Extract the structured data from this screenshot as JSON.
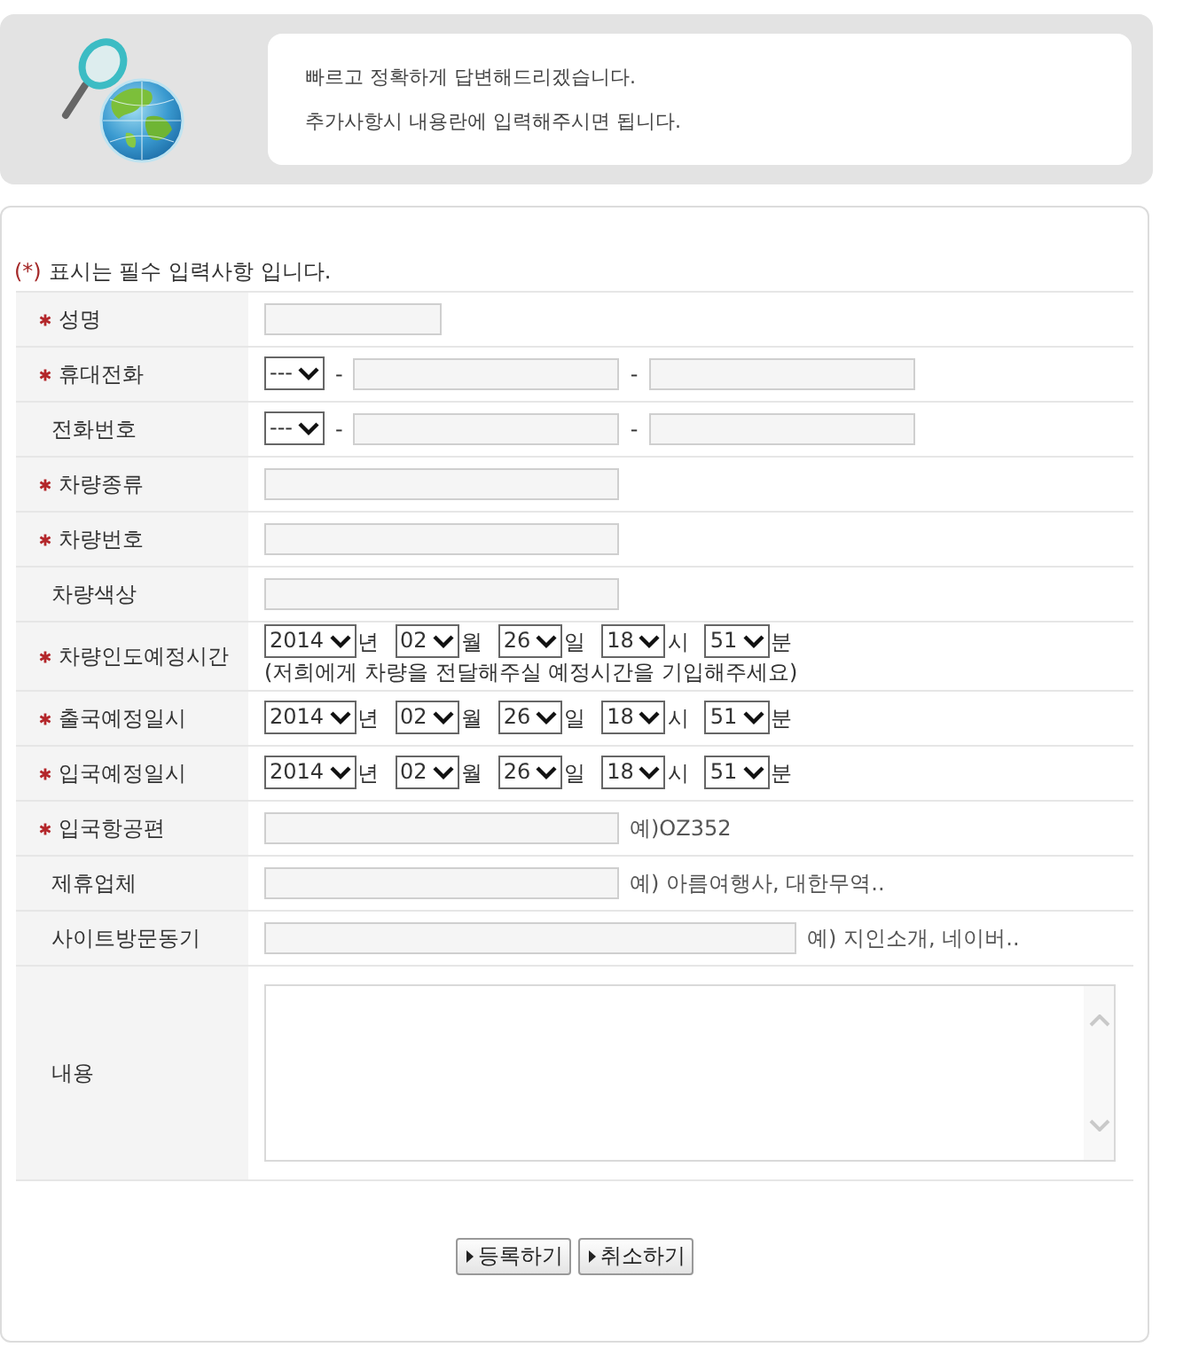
{
  "header": {
    "lines": [
      "빠르고 정확하게 답변해드리겠습니다.",
      "추가사항시 내용란에 입력해주시면 됩니다."
    ]
  },
  "notice": {
    "marker": "(*)",
    "text": "표시는 필수 입력사항 입니다."
  },
  "form_rows": [
    {
      "label": "성명",
      "required": true,
      "parts": [
        {
          "kind": "short-input"
        }
      ]
    },
    {
      "label": "휴대전화",
      "required": true,
      "parts": [
        {
          "kind": "select",
          "value": "---"
        },
        {
          "kind": "separator",
          "text": "-"
        },
        {
          "kind": "phone-input"
        },
        {
          "kind": "separator",
          "text": "-"
        },
        {
          "kind": "phone-input"
        }
      ]
    },
    {
      "label": "전화번호",
      "required": false,
      "parts": [
        {
          "kind": "select",
          "value": "---"
        },
        {
          "kind": "separator",
          "text": "-"
        },
        {
          "kind": "phone-input"
        },
        {
          "kind": "separator",
          "text": "-"
        },
        {
          "kind": "phone-input"
        }
      ]
    },
    {
      "label": "차량종류",
      "required": true,
      "parts": [
        {
          "kind": "input"
        }
      ]
    },
    {
      "label": "차량번호",
      "required": true,
      "parts": [
        {
          "kind": "input"
        }
      ]
    },
    {
      "label": "차량색상",
      "required": false,
      "parts": [
        {
          "kind": "input"
        }
      ]
    },
    {
      "label": "차량인도예정시간",
      "required": true,
      "parts": [
        {
          "kind": "select",
          "value": "2014"
        },
        {
          "kind": "unit",
          "text": "년"
        },
        {
          "kind": "select",
          "value": "02"
        },
        {
          "kind": "unit",
          "text": "월"
        },
        {
          "kind": "select",
          "value": "26"
        },
        {
          "kind": "unit",
          "text": "일"
        },
        {
          "kind": "select",
          "value": "18"
        },
        {
          "kind": "unit",
          "text": "시"
        },
        {
          "kind": "select",
          "value": "51"
        },
        {
          "kind": "unit",
          "text": "분"
        },
        {
          "kind": "note",
          "text": "(저희에게 차량을 전달해주실 예정시간을 기입해주세요)"
        }
      ]
    },
    {
      "label": "출국예정일시",
      "required": true,
      "parts": [
        {
          "kind": "select",
          "value": "2014"
        },
        {
          "kind": "unit",
          "text": "년"
        },
        {
          "kind": "select",
          "value": "02"
        },
        {
          "kind": "unit",
          "text": "월"
        },
        {
          "kind": "select",
          "value": "26"
        },
        {
          "kind": "unit",
          "text": "일"
        },
        {
          "kind": "select",
          "value": "18"
        },
        {
          "kind": "unit",
          "text": "시"
        },
        {
          "kind": "select",
          "value": "51"
        },
        {
          "kind": "unit",
          "text": "분"
        }
      ]
    },
    {
      "label": "입국예정일시",
      "required": true,
      "parts": [
        {
          "kind": "select",
          "value": "2014"
        },
        {
          "kind": "unit",
          "text": "년"
        },
        {
          "kind": "select",
          "value": "02"
        },
        {
          "kind": "unit",
          "text": "월"
        },
        {
          "kind": "select",
          "value": "26"
        },
        {
          "kind": "unit",
          "text": "일"
        },
        {
          "kind": "select",
          "value": "18"
        },
        {
          "kind": "unit",
          "text": "시"
        },
        {
          "kind": "select",
          "value": "51"
        },
        {
          "kind": "unit",
          "text": "분"
        }
      ]
    },
    {
      "label": "입국항공편",
      "required": true,
      "parts": [
        {
          "kind": "input"
        },
        {
          "kind": "hint",
          "text": "예)OZ352"
        }
      ]
    },
    {
      "label": "제휴업체",
      "required": false,
      "parts": [
        {
          "kind": "input"
        },
        {
          "kind": "hint",
          "text": "예) 아름여행사, 대한무역.."
        }
      ]
    },
    {
      "label": "사이트방문동기",
      "required": false,
      "parts": [
        {
          "kind": "wide-input"
        },
        {
          "kind": "hint",
          "text": "예) 지인소개, 네이버.."
        }
      ]
    },
    {
      "label": "내용",
      "required": false,
      "parts": [
        {
          "kind": "textarea"
        }
      ]
    }
  ],
  "buttons": [
    {
      "label": "등록하기"
    },
    {
      "label": "취소하기"
    }
  ]
}
